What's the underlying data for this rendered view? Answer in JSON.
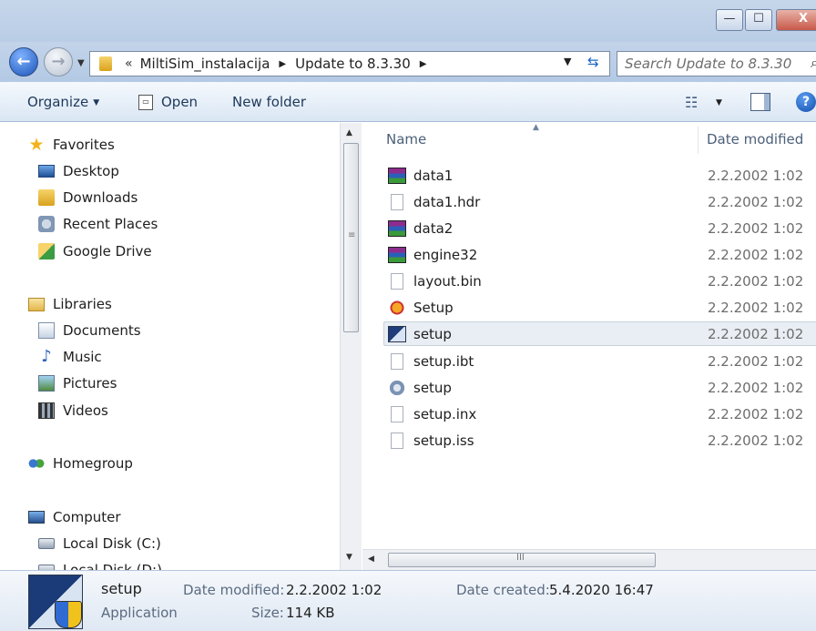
{
  "window": {
    "min_glyph": "—",
    "max_glyph": "☐",
    "close_glyph": "X"
  },
  "nav": {
    "back_glyph": "←",
    "forward_glyph": "→",
    "dropdown_glyph": "▼"
  },
  "address": {
    "more": "«",
    "crumbs": [
      "MiltiSim_instalacija",
      "Update to 8.3.30"
    ],
    "separator": "▶",
    "dropdown_glyph": "▼",
    "refresh_glyph": "⇆"
  },
  "search": {
    "placeholder": "Search Update to 8.3.30",
    "icon_glyph": "⌕"
  },
  "toolbar": {
    "organize": "Organize",
    "organize_arrow": "▼",
    "open": "Open",
    "new_folder": "New folder",
    "views_glyph": "☷",
    "views_arrow": "▼",
    "help_glyph": "?"
  },
  "sidebar": {
    "favorites": "Favorites",
    "desktop": "Desktop",
    "downloads": "Downloads",
    "recent_places": "Recent Places",
    "google_drive": "Google Drive",
    "libraries": "Libraries",
    "documents": "Documents",
    "music": "Music",
    "pictures": "Pictures",
    "videos": "Videos",
    "homegroup": "Homegroup",
    "computer": "Computer",
    "local_c": "Local Disk (C:)",
    "local_d": "Local Disk (D:)"
  },
  "scroll": {
    "up": "▲",
    "down": "▼",
    "left": "◀",
    "grip_v": "≡",
    "grip_h": "III"
  },
  "files": {
    "col_name": "Name",
    "col_date": "Date modified",
    "sort_glyph": "▲",
    "rows": [
      {
        "name": "data1",
        "date": "2.2.2002 1:02"
      },
      {
        "name": "data1.hdr",
        "date": "2.2.2002 1:02"
      },
      {
        "name": "data2",
        "date": "2.2.2002 1:02"
      },
      {
        "name": "engine32",
        "date": "2.2.2002 1:02"
      },
      {
        "name": "layout.bin",
        "date": "2.2.2002 1:02"
      },
      {
        "name": "Setup",
        "date": "2.2.2002 1:02"
      },
      {
        "name": "setup",
        "date": "2.2.2002 1:02"
      },
      {
        "name": "setup.ibt",
        "date": "2.2.2002 1:02"
      },
      {
        "name": "setup",
        "date": "2.2.2002 1:02"
      },
      {
        "name": "setup.inx",
        "date": "2.2.2002 1:02"
      },
      {
        "name": "setup.iss",
        "date": "2.2.2002 1:02"
      }
    ]
  },
  "details": {
    "name": "setup",
    "type": "Application",
    "modified_label": "Date modified:",
    "modified_value": "2.2.2002 1:02",
    "created_label": "Date created:",
    "created_value": "5.4.2020 16:47",
    "size_label": "Size:",
    "size_value": "114 KB"
  }
}
